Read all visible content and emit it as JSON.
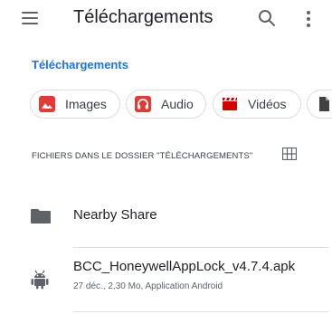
{
  "appbar": {
    "title": "Téléchargements",
    "menu_icon": "hamburger-menu-icon",
    "search_icon": "search-icon",
    "more_icon": "more-vert-icon"
  },
  "breadcrumb": {
    "label": "Téléchargements",
    "color": "#1a73e8"
  },
  "filter_chips": [
    {
      "label": "Images",
      "icon": "image-icon",
      "color": "#e53935"
    },
    {
      "label": "Audio",
      "icon": "headphones-icon",
      "color": "#e53935"
    },
    {
      "label": "Vidéos",
      "icon": "clapperboard-icon",
      "color": "#d50000"
    },
    {
      "label": "",
      "icon": "document-icon",
      "color": "#424242"
    }
  ],
  "section": {
    "label": "FICHIERS DANS LE DOSSIER \"TÉLÉCHARGEMENTS\"",
    "view_toggle_icon": "grid-view-icon"
  },
  "files": [
    {
      "name": "Nearby Share",
      "details": "",
      "icon": "folder-icon"
    },
    {
      "name": "BCC_HoneywellAppLock_v4.7.4.apk",
      "details": "27 déc., 2,30 Mo, Application Android",
      "icon": "android-icon"
    }
  ]
}
